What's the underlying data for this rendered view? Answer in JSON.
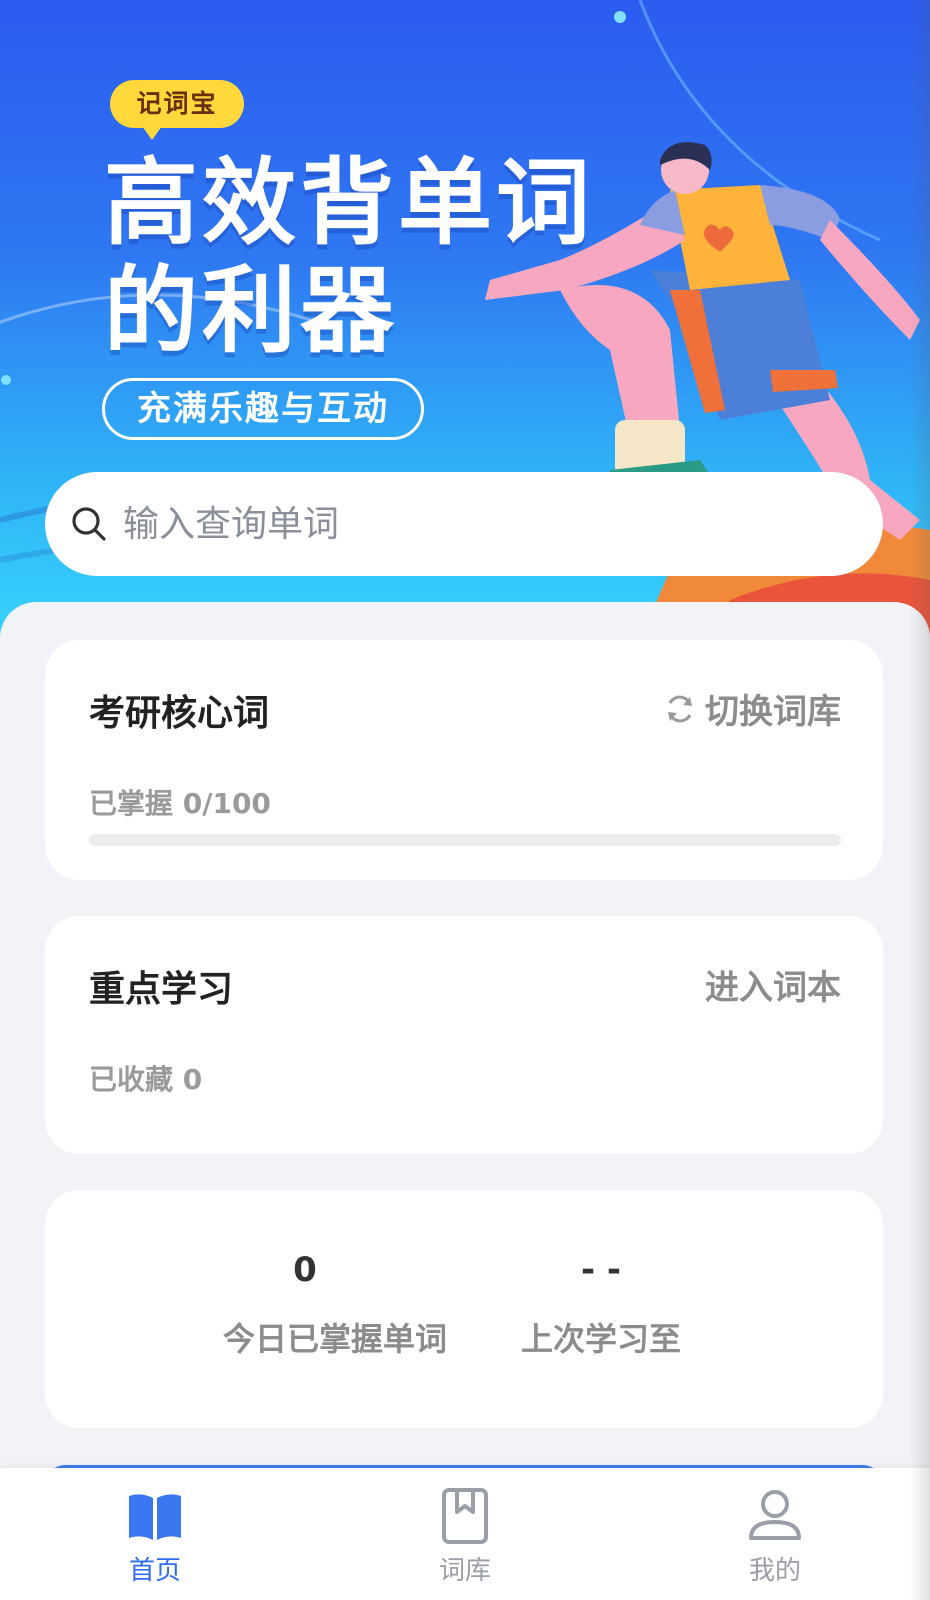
{
  "banner": {
    "tag": "记词宝",
    "headline_line1": "高效背单词",
    "headline_line2": "的利器",
    "subtitle": "充满乐趣与互动"
  },
  "search": {
    "placeholder": "输入查询单词",
    "icon": "search-icon"
  },
  "wordbook_card": {
    "title": "考研核心词",
    "action_label": "切换词库",
    "action_icon": "refresh-icon",
    "progress_text": "已掌握 0/100",
    "mastered": 0,
    "total": 100
  },
  "focus_card": {
    "title": "重点学习",
    "action_label": "进入词本",
    "collected_text": "已收藏 0"
  },
  "stats_card": {
    "today_value": "0",
    "today_label": "今日已掌握单词",
    "last_value": "- -",
    "last_label": "上次学习至"
  },
  "tabbar": {
    "items": [
      {
        "label": "首页",
        "icon": "open-book-icon",
        "active": true
      },
      {
        "label": "词库",
        "icon": "bookmark-book-icon",
        "active": false
      },
      {
        "label": "我的",
        "icon": "user-icon",
        "active": false
      }
    ]
  },
  "colors": {
    "accent": "#2f6df0",
    "banner_top": "#2b5cf0",
    "banner_bottom": "#37d3fb",
    "tag_yellow": "#ffd93b",
    "background": "#f2f3f7"
  }
}
